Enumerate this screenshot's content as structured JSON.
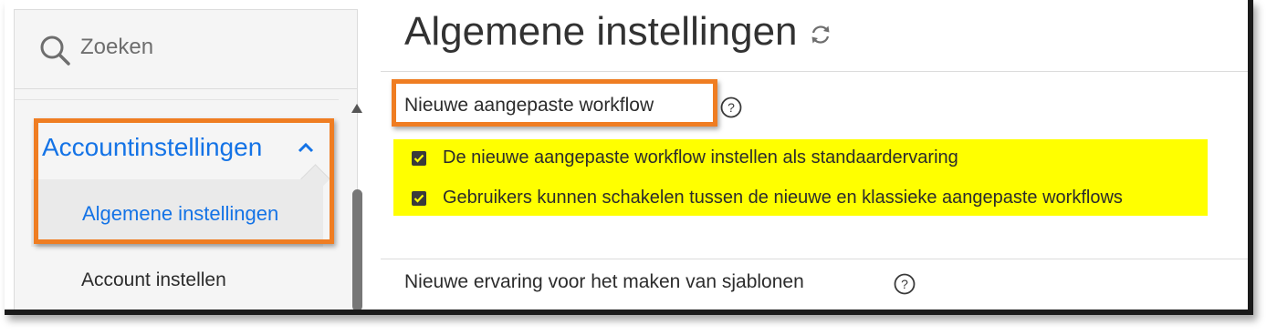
{
  "search": {
    "placeholder": "Zoeken"
  },
  "sidebar": {
    "group": {
      "label": "Accountinstellingen",
      "expanded": true
    },
    "sub_items": [
      {
        "label": "Algemene instellingen",
        "selected": true
      }
    ],
    "items": [
      {
        "label": "Account instellen"
      }
    ]
  },
  "page": {
    "title": "Algemene instellingen"
  },
  "sections": [
    {
      "heading": "Nieuwe aangepaste workflow",
      "options": [
        {
          "label": "De nieuwe aangepaste workflow instellen als standaardervaring",
          "checked": true
        },
        {
          "label": "Gebruikers kunnen schakelen tussen de nieuwe en klassieke aangepaste workflows",
          "checked": true
        }
      ]
    },
    {
      "heading": "Nieuwe ervaring voor het maken van sjablonen"
    }
  ],
  "colors": {
    "accent": "#1473e6",
    "callout": "#ef7d22",
    "highlight": "#ffff00",
    "text": "#2c2c2c"
  },
  "icons": [
    "search-icon",
    "chevron-up-icon",
    "refresh-icon",
    "help-icon",
    "checkbox-checked-icon",
    "scroll-up-icon"
  ]
}
